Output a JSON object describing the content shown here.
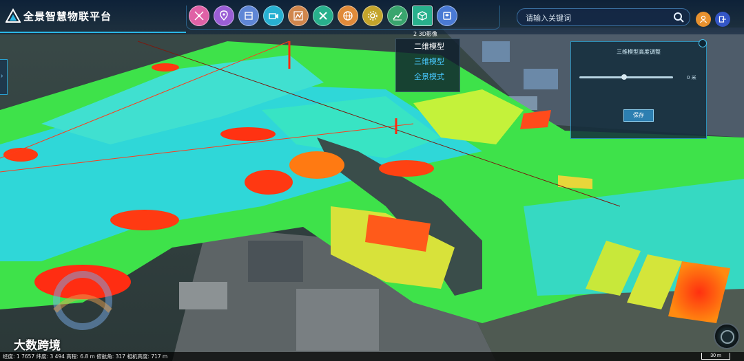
{
  "app": {
    "title": "全景智慧物联平台"
  },
  "toolbar": {
    "items": [
      {
        "name": "nodes-icon",
        "color": "#e061a6"
      },
      {
        "name": "map-pin-icon",
        "color": "#9b5ed6"
      },
      {
        "name": "layers-icon",
        "color": "#5f86d6"
      },
      {
        "name": "video-icon",
        "color": "#27b0d1"
      },
      {
        "name": "route-icon",
        "color": "#d0864c"
      },
      {
        "name": "tools-icon",
        "color": "#28b08c"
      },
      {
        "name": "globe-icon",
        "color": "#e08b3a"
      },
      {
        "name": "gear-icon",
        "color": "#c4a52b"
      },
      {
        "name": "chart-icon",
        "color": "#39a56e"
      },
      {
        "name": "cube-icon",
        "color": "#28b08c",
        "active": true
      },
      {
        "name": "box-3d-icon",
        "color": "#4a7ad4"
      }
    ]
  },
  "search": {
    "placeholder": "请输入关键词"
  },
  "tooltip": {
    "text": "2 3D影像"
  },
  "view_menu": {
    "items": [
      "二维模型",
      "三维模型",
      "全景模式"
    ]
  },
  "height_panel": {
    "title": "三维模型高度调整",
    "slider_fraction": 0.48,
    "value_text": "0 米",
    "save_label": "保存"
  },
  "status": {
    "text": "经度: 1    7657 纬度: 3       494 高程: 6.8 m 俯航角: 317 相机高度: 717 m",
    "scale_label": "30 m"
  },
  "watermark": {
    "text": "大数跨境"
  },
  "colors": {
    "accent": "#2bb8e6",
    "panel_border": "#2b8fb8",
    "menu_text": "#49c9ff"
  }
}
